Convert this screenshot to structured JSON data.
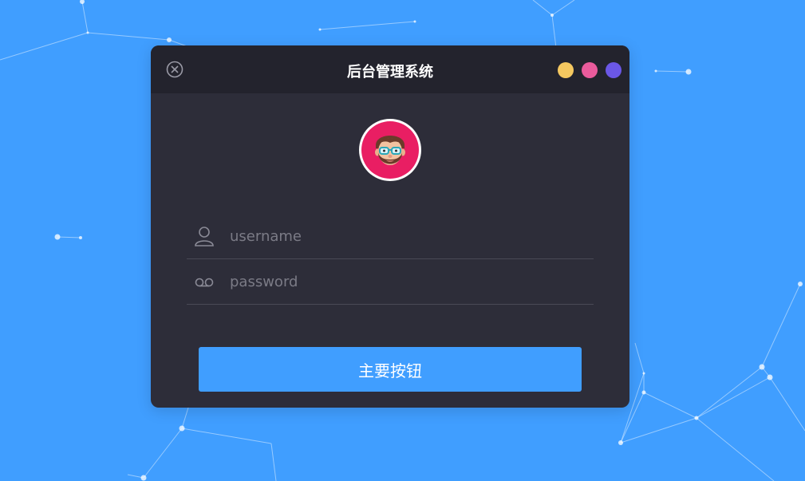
{
  "app": {
    "title": "后台管理系统",
    "background_color": "#409eff",
    "window_color": "#2d2d39",
    "titlebar_color": "#23232d"
  },
  "titlebar": {
    "close_icon": "circle-x-icon",
    "window_dots": [
      {
        "name": "yellow",
        "color": "#f5c860"
      },
      {
        "name": "pink",
        "color": "#ea5b9c"
      },
      {
        "name": "purple",
        "color": "#6b57e6"
      }
    ]
  },
  "avatar": {
    "icon": "bearded-man-with-glasses-avatar",
    "ring_color": "#e91e63"
  },
  "form": {
    "username": {
      "placeholder": "username",
      "value": "",
      "icon": "user-icon"
    },
    "password": {
      "placeholder": "password",
      "value": "",
      "icon": "voicemail-icon"
    }
  },
  "submit": {
    "label": "主要按钮",
    "color": "#409eff"
  }
}
